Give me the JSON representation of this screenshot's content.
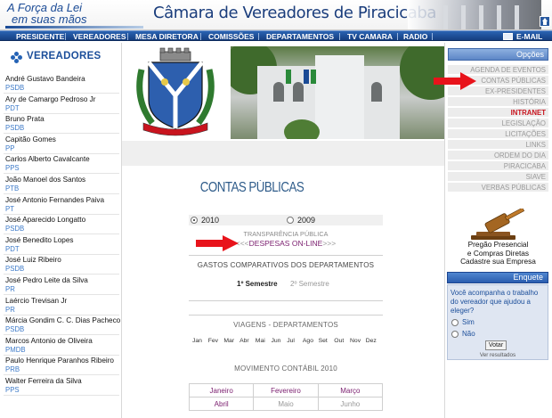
{
  "header": {
    "slogan_line1": "A Força da Lei",
    "slogan_line2": "em suas mãos",
    "title": "Câmara de Vereadores de Piracicaba"
  },
  "nav": {
    "items": [
      "PRESIDENTE",
      "VEREADORES",
      "MESA DIRETORA",
      "COMISSÕES",
      "DEPARTAMENTOS",
      "TV CAMARA",
      "RADIO",
      "E-MAIL"
    ]
  },
  "left": {
    "title": "VEREADORES",
    "vereadores": [
      {
        "name": "André Gustavo Bandeira",
        "party": "PSDB"
      },
      {
        "name": "Ary de Camargo Pedroso Jr",
        "party": "PDT"
      },
      {
        "name": "Bruno Prata",
        "party": "PSDB"
      },
      {
        "name": "Capitão Gomes",
        "party": "PP"
      },
      {
        "name": "Carlos Alberto Cavalcante",
        "party": "PPS"
      },
      {
        "name": "João Manoel dos Santos",
        "party": "PTB"
      },
      {
        "name": "José Antonio Fernandes Paiva",
        "party": "PT"
      },
      {
        "name": "José Aparecido Longatto",
        "party": "PSDB"
      },
      {
        "name": "José Benedito Lopes",
        "party": "PDT"
      },
      {
        "name": "José Luiz Ribeiro",
        "party": "PSDB"
      },
      {
        "name": "José Pedro Leite da Silva",
        "party": "PR"
      },
      {
        "name": "Laércio Trevisan Jr",
        "party": "PR"
      },
      {
        "name": "Márcia Gondim C. C. Dias Pacheco",
        "party": "PSDB"
      },
      {
        "name": "Marcos Antonio de Oliveira",
        "party": "PMDB"
      },
      {
        "name": "Paulo Henrique Paranhos Ribeiro",
        "party": "PRB"
      },
      {
        "name": "Walter Ferreira da Silva",
        "party": "PPS"
      }
    ]
  },
  "content": {
    "title": "CONTAS PÚBLICAS",
    "years": [
      "2010",
      "2009"
    ],
    "selected_year": "2010",
    "transparencia": "TRANSPARÊNCIA PÚBLICA",
    "despesas_prefix": "<<<",
    "despesas_link": "DESPESAS ON-LINE",
    "despesas_suffix": ">>>",
    "gastos_title": "GASTOS COMPARATIVOS DOS DEPARTAMENTOS",
    "semestre1": "1º Semestre",
    "semestre2": "2º Semestre",
    "viagens_title": "VIAGENS - DEPARTAMENTOS",
    "months_short": [
      "Jan",
      "Fev",
      "Mar",
      "Abr",
      "Mai",
      "Jun",
      "Jul",
      "Ago",
      "Set",
      "Out",
      "Nov",
      "Dez"
    ],
    "movimento_title": "MOVIMENTO CONTÁBIL 2010",
    "movimento_rows": [
      [
        "Janeiro",
        "Fevereiro",
        "Março"
      ],
      [
        "Abril",
        "Maio",
        "Junho"
      ]
    ]
  },
  "right": {
    "opcoes_title": "Opções",
    "options": [
      "AGENDA DE EVENTOS",
      "CONTAS PÚBLICAS",
      "EX-PRESIDENTES",
      "HISTÓRIA",
      "INTRANET",
      "LEGISLAÇÃO",
      "LICITAÇÕES",
      "LINKS",
      "ORDEM DO DIA",
      "PIRACICABA",
      "SIAVE",
      "VERBAS PÚBLICAS"
    ],
    "highlight_option": "INTRANET",
    "pregao_line1": "Pregão Presencial",
    "pregao_line2": "e Compras Diretas",
    "pregao_line3": "Cadastre sua Empresa",
    "enquete_title": "Enquete",
    "enquete_question": "Você acompanha o trabalho do vereador que ajudou a eleger?",
    "enquete_options": [
      "Sim",
      "Não"
    ],
    "votar_label": "Votar",
    "ver_resultados": "Ver resultados"
  },
  "colors": {
    "brand_blue": "#1a4a95",
    "nav_blue": "#2a63b3",
    "link_purple": "#7a1d6e",
    "party_blue": "#3d7ac8",
    "highlight_red": "#c8141e",
    "arrow_red": "#e8131b"
  },
  "icons": [
    "home-icon",
    "email-icon",
    "dots-icon",
    "arrow-icon",
    "hammer-icon",
    "brasao-emblem"
  ]
}
